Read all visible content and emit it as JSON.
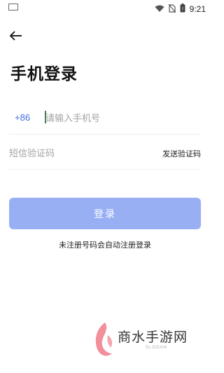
{
  "status_bar": {
    "time": "9:21",
    "icons": [
      "wifi-icon",
      "no-sim-icon",
      "battery-icon"
    ]
  },
  "header": {
    "back_icon": "arrow-left-icon",
    "title": "手机登录"
  },
  "form": {
    "country_code": "+86",
    "phone_placeholder": "请输入手机号",
    "phone_value": "",
    "code_placeholder": "短信验证码",
    "code_value": "",
    "send_code_label": "发送验证码"
  },
  "login": {
    "button_label": "登录",
    "hint": "未注册号码会自动注册登录"
  },
  "watermark": {
    "text": "商水手游网",
    "sub": "SLOGAN"
  },
  "colors": {
    "accent": "#3f6fe0",
    "button_bg": "#98aff4",
    "button_text": "#ffffff",
    "logo": "#f07b8a"
  }
}
